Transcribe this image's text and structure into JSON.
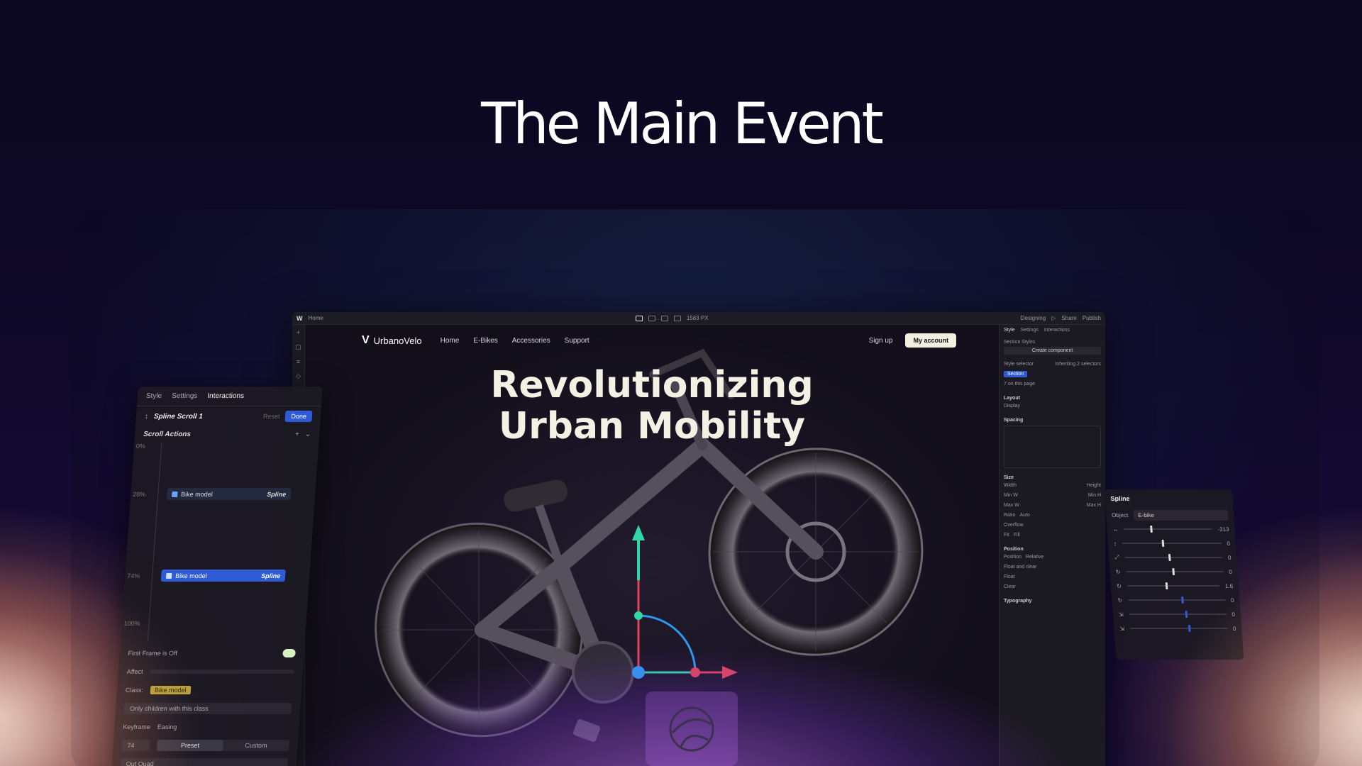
{
  "headline": "The Main Event",
  "editor": {
    "topbar": {
      "logo": "W",
      "page": "Home",
      "width_readout": "1583 PX",
      "mode": "Designing",
      "share": "Share",
      "publish": "Publish"
    },
    "site": {
      "brand": "UrbanoVelo",
      "brand_mark": "V",
      "nav": [
        "Home",
        "E-Bikes",
        "Accessories",
        "Support"
      ],
      "signup": "Sign up",
      "account": "My account",
      "hero_line1": "Revolutionizing",
      "hero_line2": "Urban Mobility"
    },
    "right_panel": {
      "tabs": [
        "Style",
        "Settings",
        "Interactions"
      ],
      "section_styles": "Section Styles",
      "create_component": "Create component",
      "style_selector": "Style selector",
      "inheriting": "Inheriting 2 selectors",
      "selector_chip": "Section",
      "on_page": "7 on this page",
      "layout": "Layout",
      "display": "Display",
      "spacing": "Spacing",
      "size": "Size",
      "width": "Width",
      "height": "Height",
      "min_w": "Min W",
      "min_h": "Min H",
      "max_w": "Max W",
      "max_h": "Max H",
      "ratio": "Ratio",
      "ratio_val": "Auto",
      "overflow": "Overflow",
      "fit": "Fit",
      "fit_val": "Fill",
      "position": "Position",
      "position_label": "Position",
      "position_val": "Relative",
      "float": "Float",
      "clear": "Clear",
      "float_and_clear": "Float and clear",
      "typography": "Typography"
    }
  },
  "interactions_panel": {
    "tabs": [
      "Style",
      "Settings",
      "Interactions"
    ],
    "title": "Spline Scroll 1",
    "reset": "Reset",
    "done": "Done",
    "section": "Scroll Actions",
    "keyframes": [
      {
        "pct": "0%"
      },
      {
        "pct": "28%",
        "label": "Bike model",
        "tag": "Spline",
        "active": false
      },
      {
        "pct": "74%",
        "label": "Bike model",
        "tag": "Spline",
        "active": true
      },
      {
        "pct": "100%"
      }
    ],
    "first_frame": "First Frame is Off",
    "affect": "Affect",
    "class_label": "Class:",
    "class_tag": "Bike model",
    "only_children": "Only children with this class",
    "keyframe": "Keyframe",
    "easing": "Easing",
    "keyframe_val": "74",
    "preset": "Preset",
    "custom": "Custom",
    "ease_val": "Out Quad"
  },
  "spline_panel": {
    "title": "Spline",
    "object_label": "Object",
    "object_val": "E-bike",
    "rows": [
      {
        "value": "-313"
      },
      {
        "value": "0"
      },
      {
        "value": "0"
      },
      {
        "value": "0"
      },
      {
        "value": "1.6"
      },
      {
        "value": "0"
      },
      {
        "value": "0"
      },
      {
        "value": "0"
      }
    ]
  },
  "colors": {
    "accent_blue": "#2f5bd6",
    "account_btn": "#f3f0df",
    "gizmo_green": "#2fd6a6",
    "gizmo_red": "#e0455a",
    "gizmo_blue": "#2b9bf0"
  }
}
